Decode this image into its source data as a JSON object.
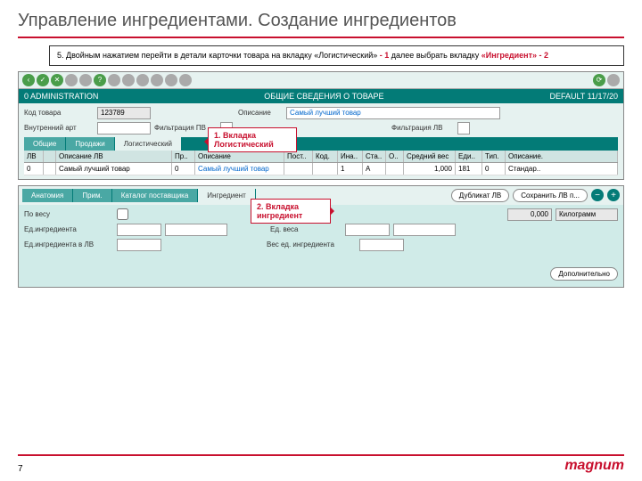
{
  "title": "Управление ингредиентами. Создание ингредиентов",
  "instruction": {
    "num": "5.",
    "t1": " Двойным нажатием перейти в детали карточки товара на вкладку «Логистический» ",
    "r1": "- 1",
    "t2": " далее выбрать вкладку ",
    "r2": "«Ингредиент» - 2"
  },
  "header": {
    "left": "0 ADMINISTRATION",
    "center": "ОБЩИЕ СВЕДЕНИЯ О ТОВАРЕ",
    "right": "DEFAULT  11/17/20"
  },
  "form": {
    "code_lbl": "Код товара",
    "code_val": "123789",
    "desc_lbl": "Описание",
    "desc_val": "Самый лучший товар",
    "art_lbl": "Внутренний арт",
    "fpv_lbl": "Фильтрация ПВ",
    "flv_lbl": "Фильтрация ЛВ"
  },
  "tabs1": [
    "Общие",
    "Продажи",
    "Логистический"
  ],
  "callout1": "1. Вкладка Логистический",
  "grid": {
    "cols": [
      "ЛВ",
      "",
      "Описание ЛВ",
      "Пр..",
      "Описание",
      "Пост..",
      "Код.",
      "Ина..",
      "Ста..",
      "О..",
      "Средний вес",
      "Еди..",
      "Тип.",
      "Описание."
    ],
    "row": [
      "0",
      "",
      "Самый лучший товар",
      "0",
      "Самый лучший товар",
      "",
      "",
      "1",
      "A",
      "",
      "1,000",
      "181",
      "0",
      "Стандар.."
    ]
  },
  "tabs2": [
    "Анатомия",
    "Прим.",
    "Каталог поставщика",
    "Ингредиент"
  ],
  "callout2": "2. Вкладка ингредиент",
  "buttons2": {
    "dup": "Дубликат ЛВ",
    "save": "Сохранить ЛВ п..."
  },
  "form2": {
    "weight_lbl": "По весу",
    "weight_val": "0,000",
    "unit": "Килограмм",
    "ing_unit_lbl": "Ед.ингредиента",
    "w_unit_lbl": "Ед. веса",
    "ing_lv_lbl": "Ед.ингредиента в ЛВ",
    "w_ing_lbl": "Вес ед. ингредиента",
    "more": "Дополнительно"
  },
  "page_num": "7",
  "logo": "magnum"
}
